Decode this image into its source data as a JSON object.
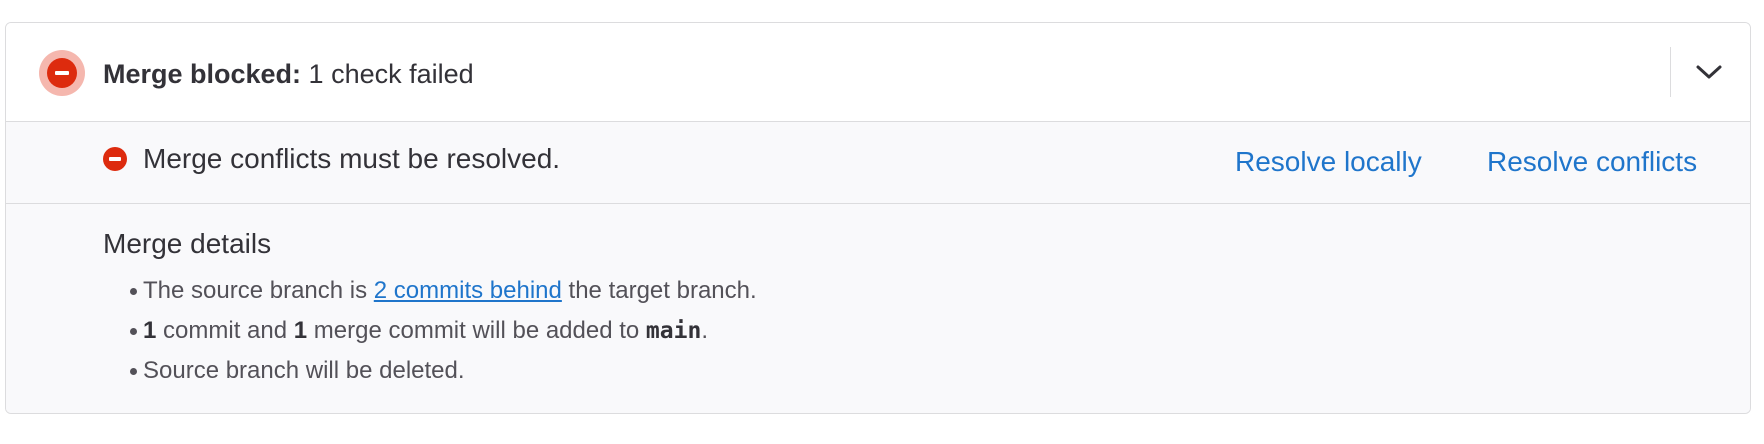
{
  "header": {
    "status_icon": "error-status-icon",
    "title_bold": "Merge blocked:",
    "title_rest": " 1 check failed",
    "toggle_icon": "chevron-down-icon"
  },
  "checks": [
    {
      "status_icon": "error-status-icon",
      "text": "Merge conflicts must be resolved.",
      "actions": [
        {
          "label": "Resolve locally"
        },
        {
          "label": "Resolve conflicts"
        }
      ]
    }
  ],
  "details": {
    "title": "Merge details",
    "items": [
      {
        "prefix": "The source branch is ",
        "link": "2 commits behind",
        "suffix": " the target branch."
      },
      {
        "count1": "1",
        "text1": " commit and ",
        "count2": "1",
        "text2": " merge commit will be added to ",
        "branch": "main",
        "text3": "."
      },
      {
        "text": "Source branch will be deleted."
      }
    ]
  },
  "colors": {
    "danger": "#dd2b0e",
    "danger_halo": "#f5b7ae",
    "link": "#1f75cb",
    "text": "#333238",
    "muted_bg": "#f9f9fb",
    "border": "#dcdcde"
  }
}
